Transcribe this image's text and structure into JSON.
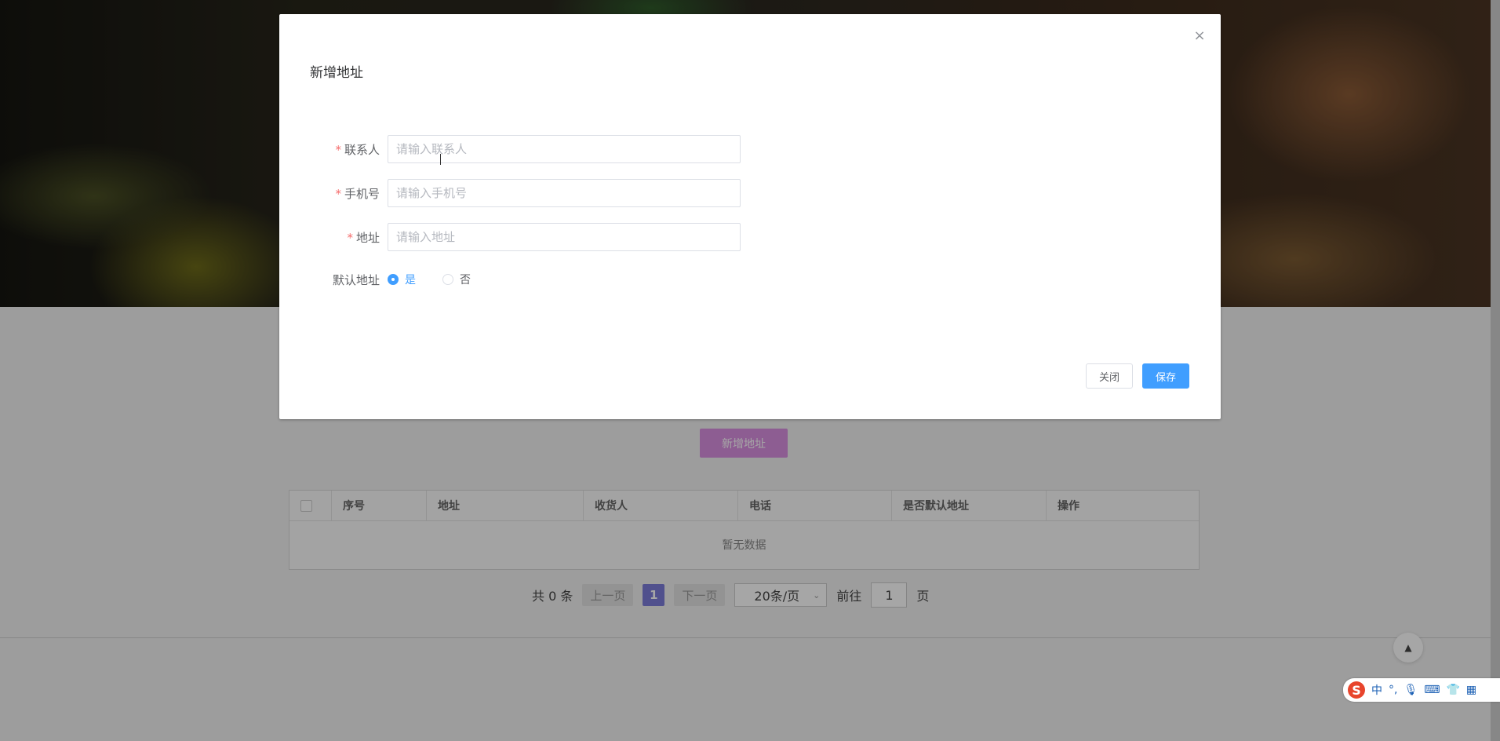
{
  "background_page": {
    "add_address_button": "新增地址",
    "table": {
      "columns": [
        "序号",
        "地址",
        "收货人",
        "电话",
        "是否默认地址",
        "操作"
      ],
      "empty_text": "暂无数据"
    },
    "pagination": {
      "total_text": "共 0 条",
      "prev_label": "上一页",
      "current_page": "1",
      "next_label": "下一页",
      "page_size": "20条/页",
      "goto_label": "前往",
      "goto_value": "1",
      "page_suffix": "页"
    }
  },
  "dialog": {
    "title": "新增地址",
    "close_icon": "close-icon",
    "fields": {
      "contact": {
        "label": "联系人",
        "required_mark": "*",
        "placeholder": "请输入联系人",
        "value": ""
      },
      "phone": {
        "label": "手机号",
        "required_mark": "*",
        "placeholder": "请输入手机号",
        "value": ""
      },
      "address": {
        "label": "地址",
        "required_mark": "*",
        "placeholder": "请输入地址",
        "value": ""
      },
      "default": {
        "label": "默认地址",
        "options": [
          "是",
          "否"
        ],
        "selected": "是"
      }
    },
    "buttons": {
      "close_label": "关闭",
      "save_label": "保存"
    }
  },
  "ime_toolbar": {
    "logo": "S",
    "mode": "中",
    "punct": "°,"
  },
  "colors": {
    "primary": "#409eff",
    "required": "#f56c6c",
    "add_button": "#d98fe0",
    "pager_current": "#7b7bd9"
  }
}
